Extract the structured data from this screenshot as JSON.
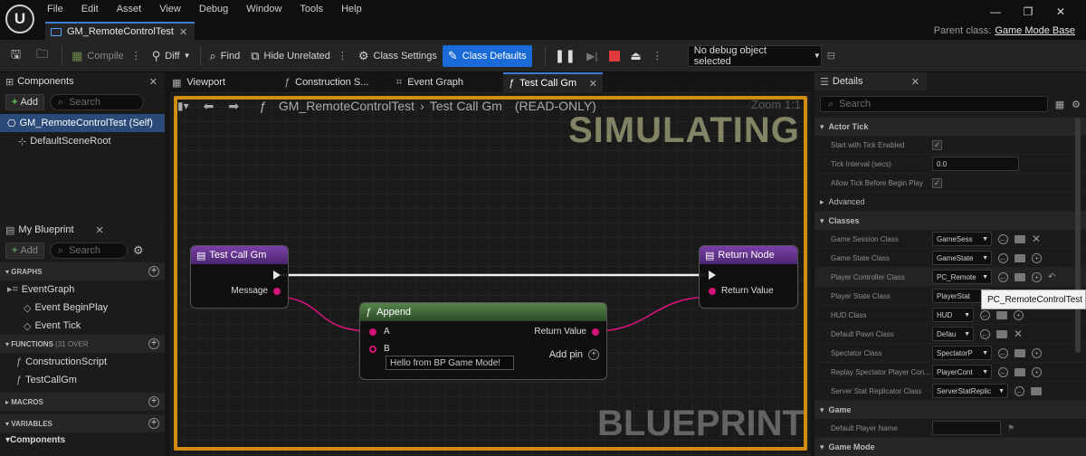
{
  "window": {
    "logo": "U",
    "menu": [
      "File",
      "Edit",
      "Asset",
      "View",
      "Debug",
      "Window",
      "Tools",
      "Help"
    ],
    "doc_tab": "GM_RemoteControlTest",
    "parent_class_label": "Parent class:",
    "parent_class_value": "Game Mode Base"
  },
  "toolbar": {
    "compile": "Compile",
    "diff": "Diff",
    "find": "Find",
    "hide_unrelated": "Hide Unrelated",
    "class_settings": "Class Settings",
    "class_defaults": "Class Defaults",
    "debug_object": "No debug object selected"
  },
  "components": {
    "tab": "Components",
    "add": "Add",
    "search_placeholder": "Search",
    "items": [
      "GM_RemoteControlTest (Self)",
      "DefaultSceneRoot"
    ]
  },
  "my_blueprint": {
    "tab": "My Blueprint",
    "add": "Add",
    "search_placeholder": "Search",
    "graphs_header": "GRAPHS",
    "graph_items": [
      "EventGraph",
      "Event BeginPlay",
      "Event Tick"
    ],
    "functions_header": "FUNCTIONS",
    "functions_count": "(31 OVER",
    "function_items": [
      "ConstructionScript",
      "TestCallGm"
    ],
    "macros_header": "MACROS",
    "variables_header": "VARIABLES",
    "components_header": "Components"
  },
  "editor_tabs": [
    "Viewport",
    "Construction S...",
    "Event Graph",
    "Test Call Gm"
  ],
  "graph": {
    "breadcrumb_root": "GM_RemoteControlTest",
    "breadcrumb_fn": "Test Call Gm",
    "readonly": "(READ-ONLY)",
    "zoom": "Zoom 1:1",
    "simulating": "SIMULATING",
    "watermark": "BLUEPRINT",
    "nodes": {
      "entry": {
        "title": "Test Call Gm",
        "pin_message": "Message"
      },
      "append": {
        "title": "Append",
        "pin_a": "A",
        "pin_b": "B",
        "b_value": "Hello from BP Game Mode!",
        "return": "Return Value",
        "add_pin": "Add pin"
      },
      "return": {
        "title": "Return Node",
        "pin_return": "Return Value"
      }
    }
  },
  "details": {
    "tab": "Details",
    "search_placeholder": "Search",
    "actor_tick_header": "Actor Tick",
    "start_tick": "Start with Tick Enabled",
    "tick_interval": "Tick Interval (secs)",
    "tick_interval_value": "0.0",
    "allow_tick": "Allow Tick Before Begin Play",
    "advanced": "Advanced",
    "classes_header": "Classes",
    "classes": [
      {
        "label": "Game Session Class",
        "value": "GameSess"
      },
      {
        "label": "Game State Class",
        "value": "GameState"
      },
      {
        "label": "Player Controller Class",
        "value": "PC_Remote"
      },
      {
        "label": "Player State Class",
        "value": "PlayerStat"
      },
      {
        "label": "HUD Class",
        "value": "HUD"
      },
      {
        "label": "Default Pawn Class",
        "value": "Defau"
      },
      {
        "label": "Spectator Class",
        "value": "SpectatorP"
      },
      {
        "label": "Replay Spectator Player Con...",
        "value": "PlayerCont"
      },
      {
        "label": "Server Stat Replicator Class",
        "value": "ServerStatReplic"
      }
    ],
    "game_header": "Game",
    "default_player_name": "Default Player Name",
    "game_mode_header": "Game Mode",
    "tooltip": "PC_RemoteControlTest"
  }
}
